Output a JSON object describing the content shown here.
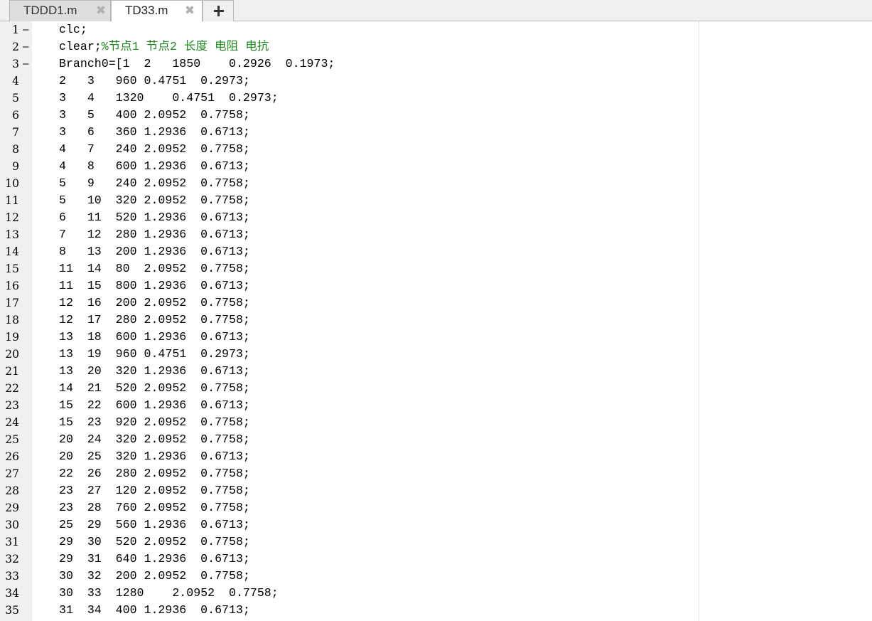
{
  "tabs": [
    {
      "label": "TDDD1.m",
      "active": false
    },
    {
      "label": "TD33.m",
      "active": true
    }
  ],
  "colors": {
    "comment": "#228b22",
    "gutter": "#f0f0f0",
    "tab_inactive": "#dedede"
  },
  "icons": {
    "close": "close-icon",
    "add": "plus-icon"
  },
  "glyphs": {
    "close": "✖"
  },
  "editor": {
    "lines": [
      {
        "num": "1",
        "bp": "–",
        "code": "clc;",
        "comment": ""
      },
      {
        "num": "2",
        "bp": "–",
        "code": "clear;",
        "comment": "%节点1 节点2 长度 电阻 电抗"
      },
      {
        "num": "3",
        "bp": "–",
        "code": "Branch0=[1  2   1850    0.2926  0.1973;",
        "comment": ""
      },
      {
        "num": "4",
        "bp": "",
        "code": "2   3   960 0.4751  0.2973;",
        "comment": ""
      },
      {
        "num": "5",
        "bp": "",
        "code": "3   4   1320    0.4751  0.2973;",
        "comment": ""
      },
      {
        "num": "6",
        "bp": "",
        "code": "3   5   400 2.0952  0.7758;",
        "comment": ""
      },
      {
        "num": "7",
        "bp": "",
        "code": "3   6   360 1.2936  0.6713;",
        "comment": ""
      },
      {
        "num": "8",
        "bp": "",
        "code": "4   7   240 2.0952  0.7758;",
        "comment": ""
      },
      {
        "num": "9",
        "bp": "",
        "code": "4   8   600 1.2936  0.6713;",
        "comment": ""
      },
      {
        "num": "10",
        "bp": "",
        "code": "5   9   240 2.0952  0.7758;",
        "comment": ""
      },
      {
        "num": "11",
        "bp": "",
        "code": "5   10  320 2.0952  0.7758;",
        "comment": ""
      },
      {
        "num": "12",
        "bp": "",
        "code": "6   11  520 1.2936  0.6713;",
        "comment": ""
      },
      {
        "num": "13",
        "bp": "",
        "code": "7   12  280 1.2936  0.6713;",
        "comment": ""
      },
      {
        "num": "14",
        "bp": "",
        "code": "8   13  200 1.2936  0.6713;",
        "comment": ""
      },
      {
        "num": "15",
        "bp": "",
        "code": "11  14  80  2.0952  0.7758;",
        "comment": ""
      },
      {
        "num": "16",
        "bp": "",
        "code": "11  15  800 1.2936  0.6713;",
        "comment": ""
      },
      {
        "num": "17",
        "bp": "",
        "code": "12  16  200 2.0952  0.7758;",
        "comment": ""
      },
      {
        "num": "18",
        "bp": "",
        "code": "12  17  280 2.0952  0.7758;",
        "comment": ""
      },
      {
        "num": "19",
        "bp": "",
        "code": "13  18  600 1.2936  0.6713;",
        "comment": ""
      },
      {
        "num": "20",
        "bp": "",
        "code": "13  19  960 0.4751  0.2973;",
        "comment": ""
      },
      {
        "num": "21",
        "bp": "",
        "code": "13  20  320 1.2936  0.6713;",
        "comment": ""
      },
      {
        "num": "22",
        "bp": "",
        "code": "14  21  520 2.0952  0.7758;",
        "comment": ""
      },
      {
        "num": "23",
        "bp": "",
        "code": "15  22  600 1.2936  0.6713;",
        "comment": ""
      },
      {
        "num": "24",
        "bp": "",
        "code": "15  23  920 2.0952  0.7758;",
        "comment": ""
      },
      {
        "num": "25",
        "bp": "",
        "code": "20  24  320 2.0952  0.7758;",
        "comment": ""
      },
      {
        "num": "26",
        "bp": "",
        "code": "20  25  320 1.2936  0.6713;",
        "comment": ""
      },
      {
        "num": "27",
        "bp": "",
        "code": "22  26  280 2.0952  0.7758;",
        "comment": ""
      },
      {
        "num": "28",
        "bp": "",
        "code": "23  27  120 2.0952  0.7758;",
        "comment": ""
      },
      {
        "num": "29",
        "bp": "",
        "code": "23  28  760 2.0952  0.7758;",
        "comment": ""
      },
      {
        "num": "30",
        "bp": "",
        "code": "25  29  560 1.2936  0.6713;",
        "comment": ""
      },
      {
        "num": "31",
        "bp": "",
        "code": "29  30  520 2.0952  0.7758;",
        "comment": ""
      },
      {
        "num": "32",
        "bp": "",
        "code": "29  31  640 1.2936  0.6713;",
        "comment": ""
      },
      {
        "num": "33",
        "bp": "",
        "code": "30  32  200 2.0952  0.7758;",
        "comment": ""
      },
      {
        "num": "34",
        "bp": "",
        "code": "30  33  1280    2.0952  0.7758;",
        "comment": ""
      },
      {
        "num": "35",
        "bp": "",
        "code": "31  34  400 1.2936  0.6713;",
        "comment": ""
      }
    ]
  }
}
